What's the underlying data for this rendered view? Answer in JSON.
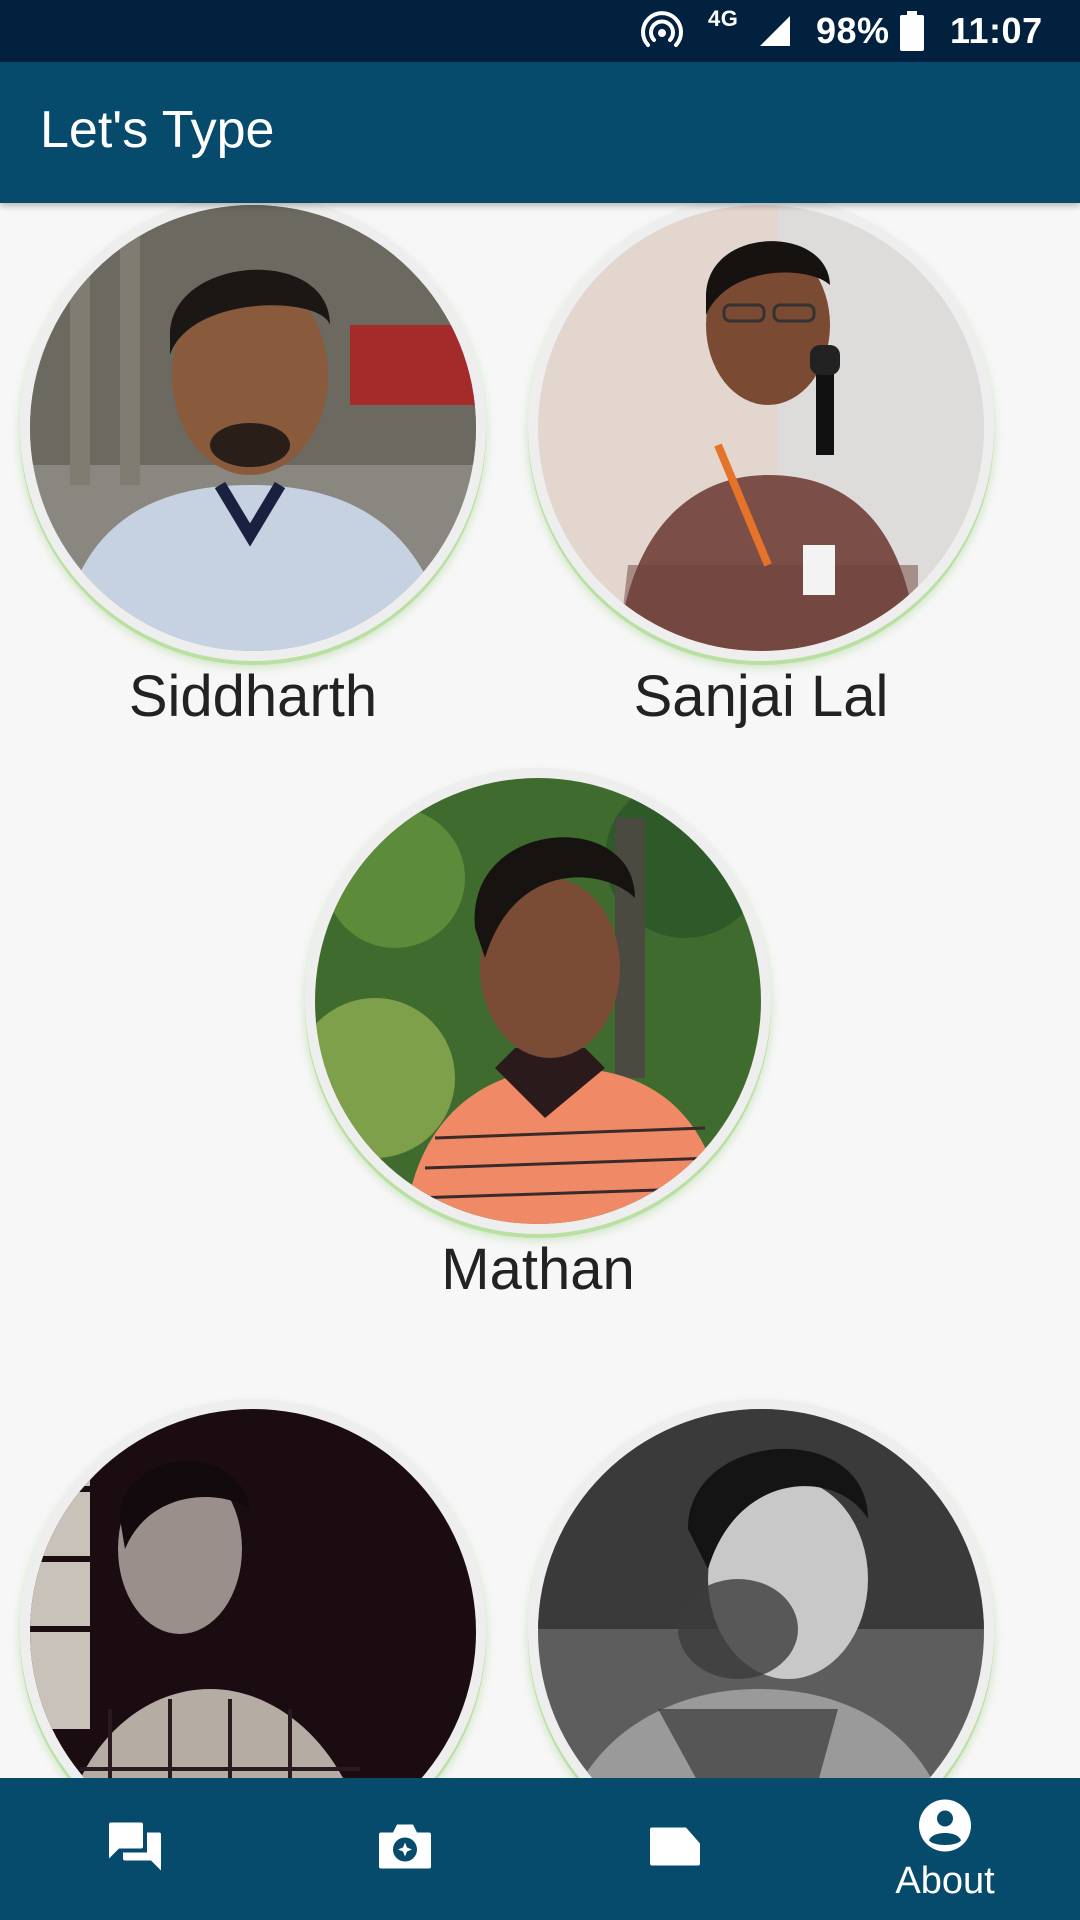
{
  "status_bar": {
    "network": "4G",
    "battery": "98%",
    "time": "11:07"
  },
  "app_bar": {
    "title": "Let's Type"
  },
  "members": [
    {
      "name": "Siddharth",
      "photo": "photo-siddharth"
    },
    {
      "name": "Sanjai Lal",
      "photo": "photo-sanjai-lal"
    },
    {
      "name": "Mathan",
      "photo": "photo-mathan"
    },
    {
      "name": "",
      "photo": "photo-member-4"
    },
    {
      "name": "",
      "photo": "photo-member-5"
    }
  ],
  "bottom_nav": {
    "items": [
      {
        "icon": "chat-icon",
        "label": ""
      },
      {
        "icon": "camera-icon",
        "label": ""
      },
      {
        "icon": "label-icon",
        "label": ""
      },
      {
        "icon": "account-circle-icon",
        "label": "About",
        "active": true
      }
    ]
  },
  "colors": {
    "status_bar": "#02213f",
    "app_bar": "#064b6c",
    "background": "#f7f7f7",
    "ring_accent": "#b8e0a0"
  }
}
